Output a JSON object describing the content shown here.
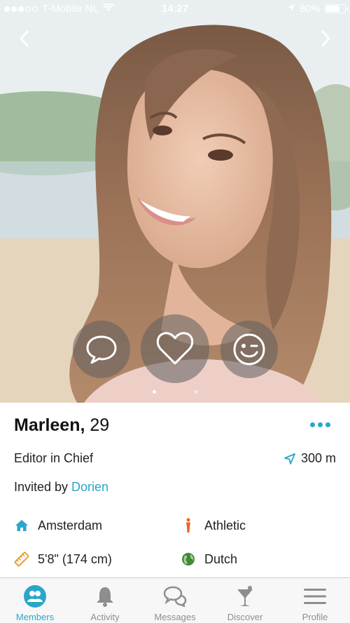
{
  "status_bar": {
    "carrier": "T-Mobile NL",
    "time": "14:27",
    "battery_percent": "80%",
    "battery_level": 0.8,
    "signal_dots_filled": 3,
    "signal_dots_total": 5
  },
  "hero": {
    "prev_icon": "chevron-left-icon",
    "next_icon": "chevron-right-icon",
    "actions": [
      {
        "name": "message",
        "icon": "speech-bubble-icon"
      },
      {
        "name": "like",
        "icon": "heart-icon"
      },
      {
        "name": "wink",
        "icon": "wink-smiley-icon"
      }
    ],
    "photo_index": 1,
    "photo_count": 2
  },
  "profile": {
    "name": "Marleen,",
    "age": "29",
    "job": "Editor in Chief",
    "distance": "300 m",
    "invited_prefix": "Invited by ",
    "invited_by": "Dorien",
    "attributes": {
      "city": "Amsterdam",
      "body": "Athletic",
      "height": "5'8\" (174 cm)",
      "language": "Dutch"
    }
  },
  "tabs": [
    {
      "label": "Members",
      "icon": "members-icon",
      "active": true
    },
    {
      "label": "Activity",
      "icon": "bell-icon",
      "active": false
    },
    {
      "label": "Messages",
      "icon": "chat-bubbles-icon",
      "active": false
    },
    {
      "label": "Discover",
      "icon": "cocktail-icon",
      "active": false
    },
    {
      "label": "Profile",
      "icon": "hamburger-menu-icon",
      "active": false
    }
  ],
  "colors": {
    "accent": "#2aa6c9",
    "inactive": "#8e8e8e",
    "body_icon": "#e8642c",
    "height_icon": "#e8962c",
    "globe_icon": "#3f8a3a"
  }
}
